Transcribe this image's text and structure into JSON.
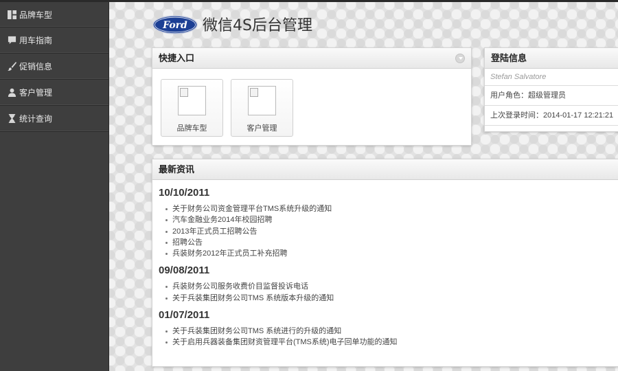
{
  "header": {
    "logo_text": "Ford",
    "title": "微信4S后台管理"
  },
  "sidebar": {
    "items": [
      {
        "label": "品牌车型",
        "icon": "grid-icon"
      },
      {
        "label": "用车指南",
        "icon": "chat-icon"
      },
      {
        "label": "促销信息",
        "icon": "brush-icon"
      },
      {
        "label": "客户管理",
        "icon": "user-icon"
      },
      {
        "label": "统计查询",
        "icon": "hourglass-icon"
      }
    ]
  },
  "quick_panel": {
    "title": "快捷入口",
    "tiles": [
      {
        "label": "品牌车型"
      },
      {
        "label": "客户管理"
      }
    ]
  },
  "login_panel": {
    "title": "登陆信息",
    "username": "Stefan Salvatore",
    "role": "用户角色：超级管理员",
    "last_login": "上次登录时间：2014-01-17 12:21:21"
  },
  "news_panel": {
    "title": "最新资讯",
    "groups": [
      {
        "date": "10/10/2011",
        "items": [
          "关于财务公司资金管理平台TMS系统升级的通知",
          "汽车金融业务2014年校园招聘",
          "2013年正式员工招聘公告",
          "招聘公告",
          "兵装财务2012年正式员工补充招聘"
        ]
      },
      {
        "date": "09/08/2011",
        "items": [
          "兵装财务公司服务收费价目监督投诉电话",
          "关于兵装集团财务公司TMS 系统版本升级的通知"
        ]
      },
      {
        "date": "01/07/2011",
        "items": [
          "关于兵装集团财务公司TMS 系统进行的升级的通知",
          "关于启用兵器装备集团财资管理平台(TMS系统)电子回单功能的通知"
        ]
      }
    ]
  },
  "colors": {
    "sidebar_bg": "#3e3e3e",
    "ford_blue": "#1c3f94"
  }
}
